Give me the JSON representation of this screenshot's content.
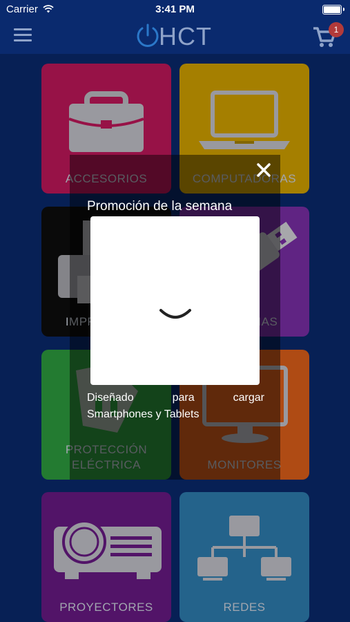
{
  "status_bar": {
    "carrier": "Carrier",
    "time": "3:41 PM"
  },
  "header": {
    "logo_text": "HCT",
    "cart_count": "1"
  },
  "categories": [
    {
      "label": "ACCESORIOS",
      "color": "#c2185b"
    },
    {
      "label": "COMPUTADORAS",
      "color": "#d4a300"
    },
    {
      "label": "IMPRESORAS",
      "color": "#0d0d0d"
    },
    {
      "label": "MEMORIAS",
      "color": "#7b2fa8"
    },
    {
      "label": "PROTECCIÓN ELÉCTRICA",
      "color": "#2e9e3f"
    },
    {
      "label": "MONITORES",
      "color": "#e0601a"
    },
    {
      "label": "PROYECTORES",
      "color": "#6a1a86"
    },
    {
      "label": "REDES",
      "color": "#2f7fb2"
    }
  ],
  "promo": {
    "title": "Promoción de la semana",
    "desc_line1_words": [
      "Diseñado",
      "para",
      "cargar"
    ],
    "desc_line2": "Smartphones y Tablets"
  }
}
